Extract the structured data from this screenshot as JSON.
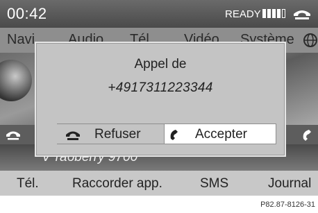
{
  "status": {
    "time": "00:42",
    "ready_label": "READY",
    "signal_bars_filled": 4,
    "signal_bars_total": 5
  },
  "tabs": [
    {
      "label": "Navi"
    },
    {
      "label": "Audio"
    },
    {
      "label": "Tél."
    },
    {
      "label": "Vidéo"
    },
    {
      "label": "Système"
    }
  ],
  "background": {
    "device_name": "Ѵ raбberry 9700"
  },
  "dialog": {
    "title": "Appel de",
    "number": "+4917311223344",
    "refuse_label": "Refuser",
    "accept_label": "Accepter"
  },
  "bottom_menu": {
    "items": [
      {
        "label": "Tél."
      },
      {
        "label": "Raccorder app."
      },
      {
        "label": "SMS"
      },
      {
        "label": "Journal"
      }
    ]
  },
  "footer": {
    "code": "P82.87-8126-31"
  },
  "colors": {
    "status_bar": "#555555",
    "tab_bar": "#8e8e8e",
    "dialog_bg": "#c4c4c4",
    "accept_bg": "#ffffff",
    "menu_bg": "#c8c8c8"
  },
  "icons": {
    "status_phone": "handset-icon",
    "globe": "globe-icon",
    "refuse": "end-call-icon",
    "accept": "accept-call-icon"
  }
}
